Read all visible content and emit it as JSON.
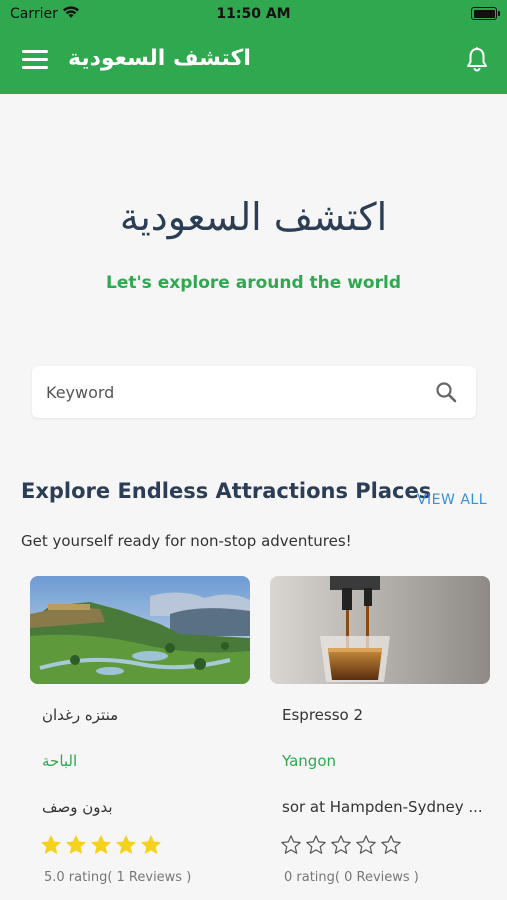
{
  "status_bar": {
    "carrier": "Carrier",
    "time": "11:50 AM"
  },
  "app_bar": {
    "title": "اكتشف السعودية"
  },
  "hero": {
    "title": "اكتشف السعودية",
    "subtitle": "Let's explore around the world"
  },
  "search": {
    "placeholder": "Keyword",
    "value": ""
  },
  "section": {
    "title": "Explore Endless Attractions Places",
    "view_all": "VIEW ALL",
    "subtitle": "Get yourself ready for non-stop adventures!"
  },
  "cards": [
    {
      "name": "منتزه رغدان",
      "city": "الباحة",
      "description": "بدون وصف",
      "stars": 5,
      "rating": "5.0 rating( 1 Reviews )",
      "image": "park-landscape"
    },
    {
      "name": "Espresso 2",
      "city": "Yangon",
      "description": "sor at Hampden-Sydney ...",
      "stars": 0,
      "rating": "0 rating( 0 Reviews )",
      "image": "espresso-shot"
    }
  ],
  "colors": {
    "primary": "#2fa84f",
    "title": "#2c3e55",
    "link": "#3a8fd6",
    "star": "#f5d31d"
  }
}
